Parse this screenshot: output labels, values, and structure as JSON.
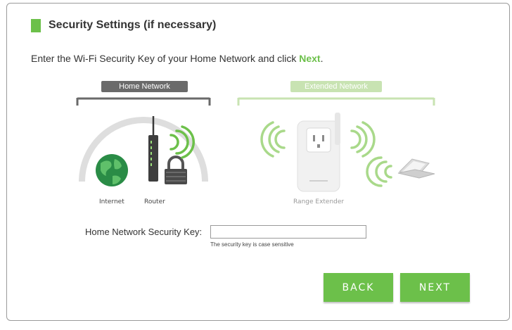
{
  "header": {
    "title": "Security Settings (if necessary)"
  },
  "instruction": {
    "text": "Enter the Wi-Fi Security Key of your Home Network and click ",
    "highlight": "Next",
    "suffix": "."
  },
  "diagram": {
    "home_network_label": "Home Network",
    "extended_network_label": "Extended Network",
    "internet_label": "Internet",
    "router_label": "Router",
    "extender_label": "Range Extender"
  },
  "form": {
    "security_key_label": "Home Network Security Key:",
    "security_key_value": "",
    "security_key_hint": "The security key is case sensitive"
  },
  "buttons": {
    "back": "BACK",
    "next": "NEXT"
  },
  "colors": {
    "accent": "#6cc04a",
    "home_tag": "#6a6a6a",
    "ext_tag": "#c8e3b2"
  },
  "icons": [
    "globe-icon",
    "router-icon",
    "lock-icon",
    "wifi-signal-icon",
    "range-extender-icon",
    "laptop-icon"
  ]
}
